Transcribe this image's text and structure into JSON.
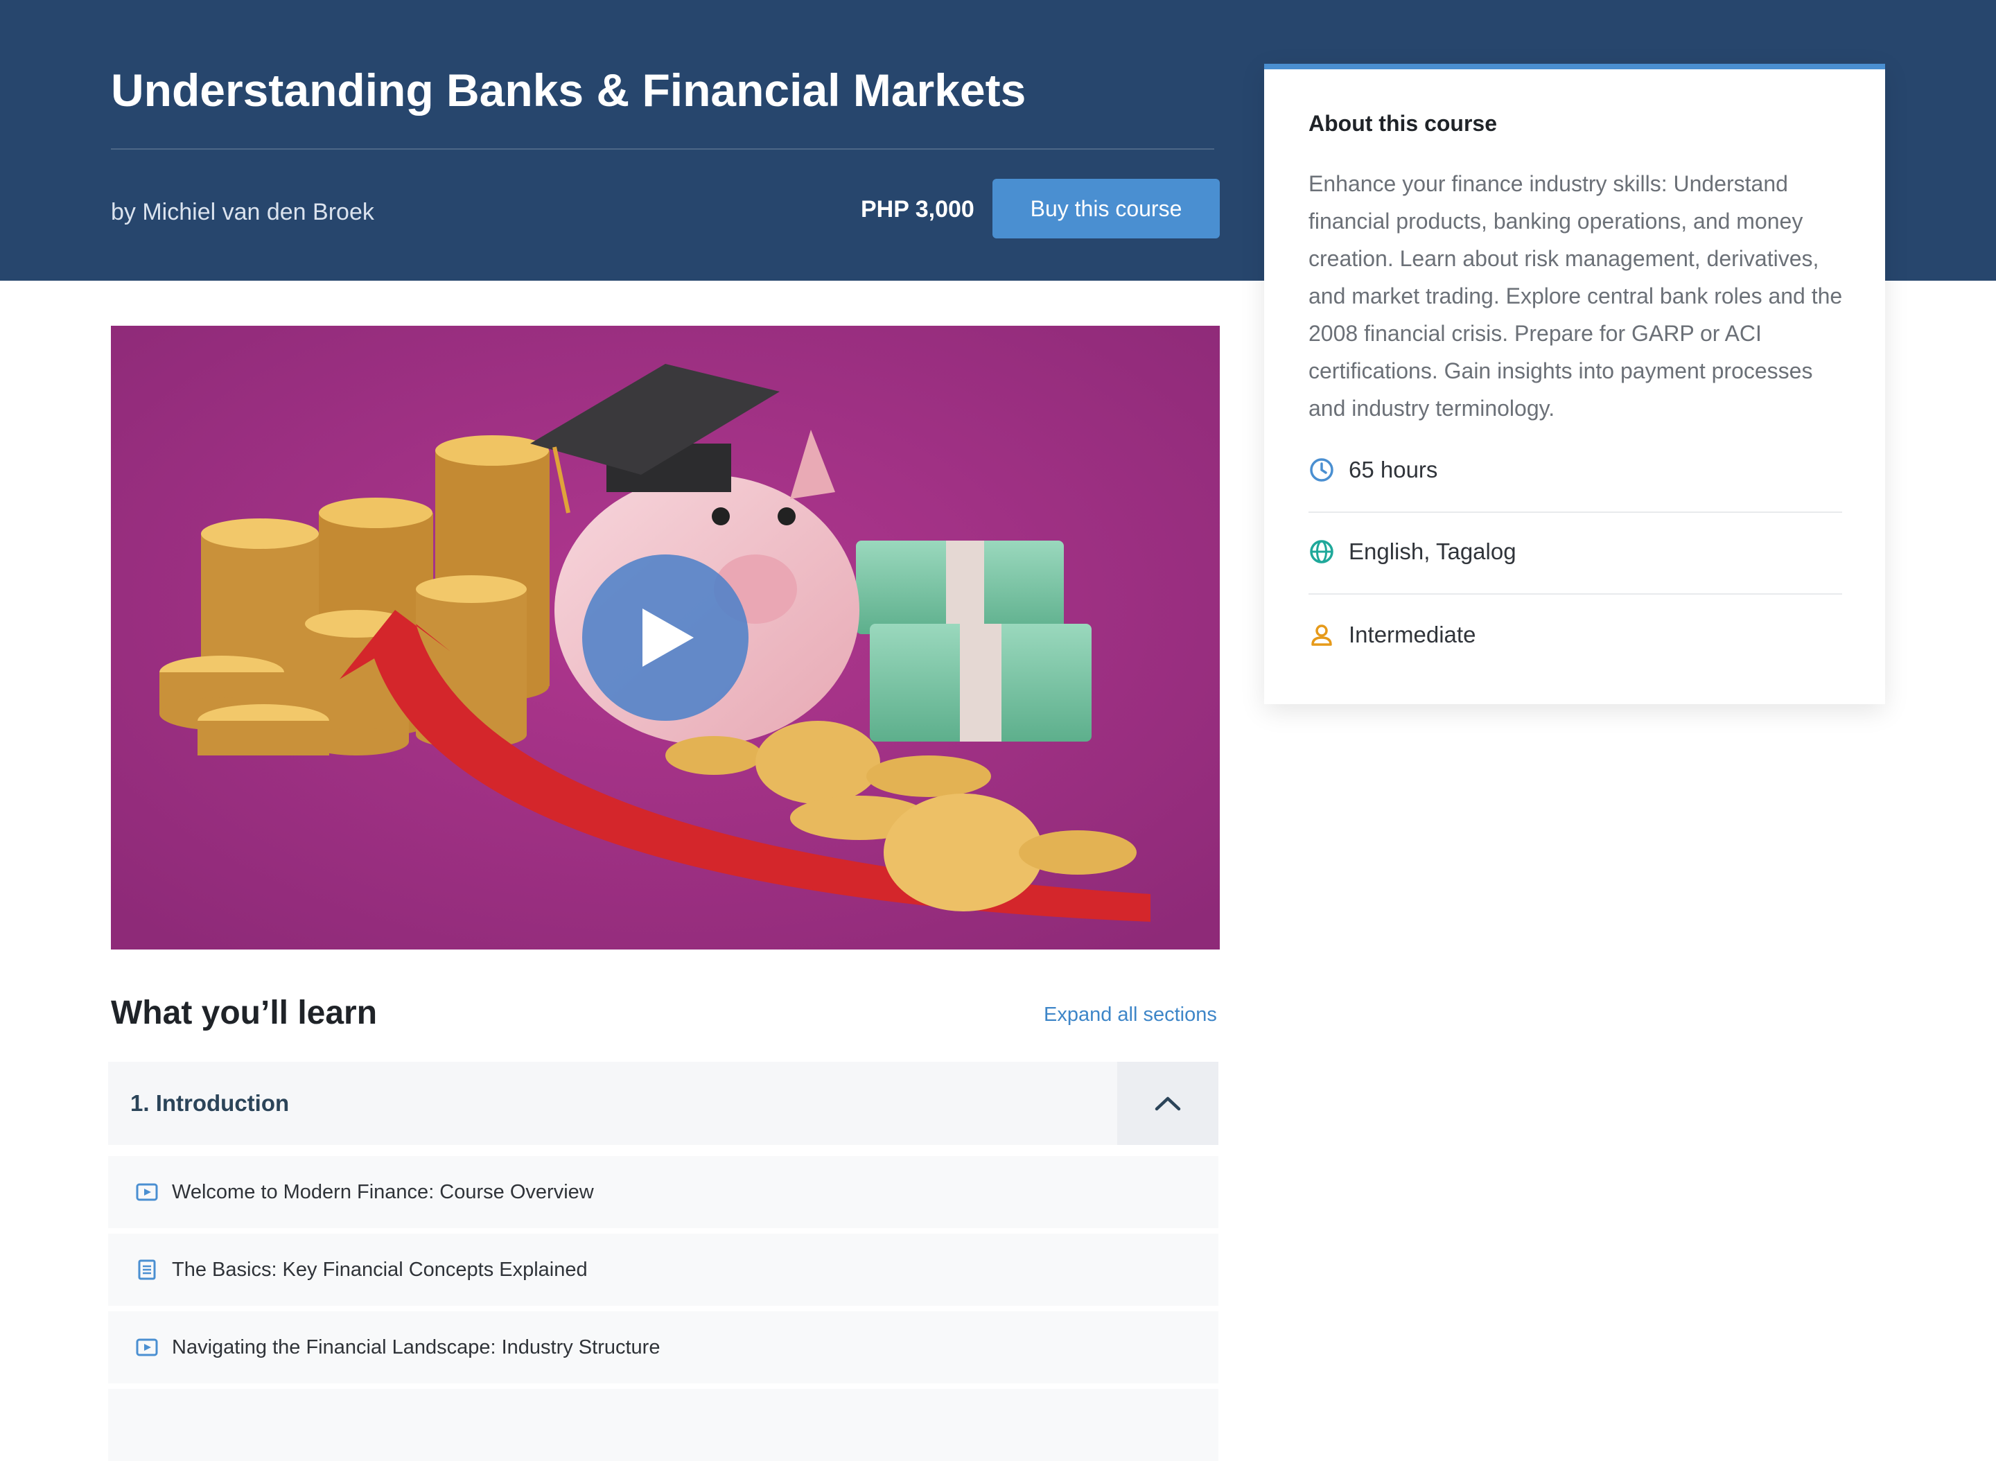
{
  "header": {
    "title": "Understanding Banks & Financial Markets",
    "author": "by Michiel van den Broek",
    "price": "PHP 3,000",
    "buy_label": "Buy this course"
  },
  "about": {
    "title": "About this course",
    "description": "Enhance your finance industry skills: Understand financial products, banking operations, and money creation. Learn about risk management, derivatives, and market trading. Explore central bank roles and the 2008 financial crisis. Prepare for GARP or ACI certifications. Gain insights into payment processes and industry terminology.",
    "meta": [
      {
        "icon": "clock-icon",
        "text": "65 hours"
      },
      {
        "icon": "globe-icon",
        "text": "English, Tagalog"
      },
      {
        "icon": "user-icon",
        "text": "Intermediate"
      }
    ]
  },
  "video": {
    "icon": "play-icon"
  },
  "learn": {
    "title": "What you’ll learn",
    "expand_label": "Expand all sections",
    "section": {
      "label": "1. Introduction",
      "toggle_icon": "chevron-up-icon",
      "lessons": [
        {
          "icon": "video-icon",
          "title": "Welcome to Modern Finance: Course Overview"
        },
        {
          "icon": "document-icon",
          "title": "The Basics: Key Financial Concepts Explained"
        },
        {
          "icon": "video-icon",
          "title": "Navigating the Financial Landscape: Industry Structure"
        }
      ]
    }
  },
  "colors": {
    "header_bg": "#27466d",
    "accent": "#4a8fd1",
    "link": "#3e86c8",
    "video_bg": "#9a2f80",
    "clock": "#4a8fd1",
    "globe": "#1fa89a",
    "level": "#e69a1a"
  }
}
